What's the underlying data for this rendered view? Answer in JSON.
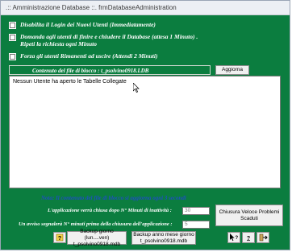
{
  "window": {
    "title": ".:: Amministrazione Database ::.   frmDatabaseAdministration"
  },
  "options": [
    {
      "lines": [
        "Disabilita il Login dei Nuovi Utenti (Immediatamente)"
      ]
    },
    {
      "lines": [
        "Domanda agli utenti di finire e chiudere il Database (attesa 1 Minuto) .",
        "Ripeti la richiesta ogni Minuto"
      ]
    },
    {
      "lines": [
        "Forza gli utenti Rimanenti ad uscire  (Attendi 2 Minuti)"
      ]
    }
  ],
  "lock_file": {
    "label": "Contenuto del file di blocco :   t_psolvino0918.LDB",
    "refresh_button": "Aggiorna",
    "content": "Nessun Utente ha aperto le Tabelle Collegate"
  },
  "note": "Nota: Il contenuto del file di blocco si aggiorna ogni 3 secondi",
  "close_after": {
    "label": "L'applicazione verrà chiusa dopo N° Minuti di inattività :",
    "value": "30"
  },
  "warn_before": {
    "label": "Un avviso segnalerà N° minuti prima della chiusura dell'applicazione :",
    "value": "5"
  },
  "quick_close_button": "Chiusura Veloce  Problemi Scaduti",
  "backup": {
    "day_button_line1": "Backup giorno (lun....ven)",
    "day_button_line2": "t_psolvino0918.mdb",
    "year_button_line1": "Backup anno mese giorno",
    "year_button_line2": "t_psolvino0918.mdb"
  },
  "icons": [
    "help-icon",
    "help-cursor-icon",
    "info-icon",
    "exit-icon"
  ]
}
